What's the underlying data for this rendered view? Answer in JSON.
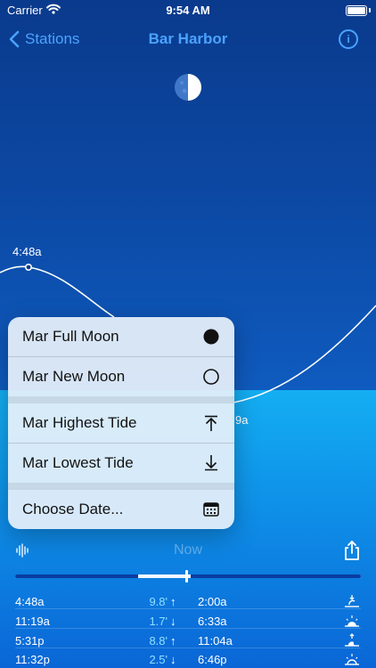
{
  "status_bar": {
    "carrier": "Carrier",
    "time": "9:54 AM"
  },
  "nav": {
    "back_label": "Stations",
    "title": "Bar Harbor",
    "info_glyph": "i"
  },
  "tide_chart": {
    "high_label": "4:48a",
    "low_label_partial": "9a"
  },
  "menu": {
    "items": [
      {
        "label": "Mar Full Moon",
        "icon": "filled-circle-icon"
      },
      {
        "label": "Mar New Moon",
        "icon": "empty-circle-icon"
      },
      {
        "label": "Mar Highest Tide",
        "icon": "arrow-up-to-line-icon"
      },
      {
        "label": "Mar Lowest Tide",
        "icon": "arrow-down-to-line-icon"
      },
      {
        "label": "Choose Date...",
        "icon": "calendar-icon"
      }
    ]
  },
  "controls": {
    "now_label": "Now"
  },
  "tides": [
    {
      "time": "4:48a",
      "height": "9.8'",
      "dir": "↑",
      "sun_time": "2:00a",
      "sun_icon": "moonset-icon"
    },
    {
      "time": "11:19a",
      "height": "1.7'",
      "dir": "↓",
      "sun_time": "6:33a",
      "sun_icon": "sunrise-icon"
    },
    {
      "time": "5:31p",
      "height": "8.8'",
      "dir": "↑",
      "sun_time": "11:04a",
      "sun_icon": "moonrise-icon"
    },
    {
      "time": "11:32p",
      "height": "2.5'",
      "dir": "↓",
      "sun_time": "6:46p",
      "sun_icon": "sunset-icon"
    }
  ]
}
